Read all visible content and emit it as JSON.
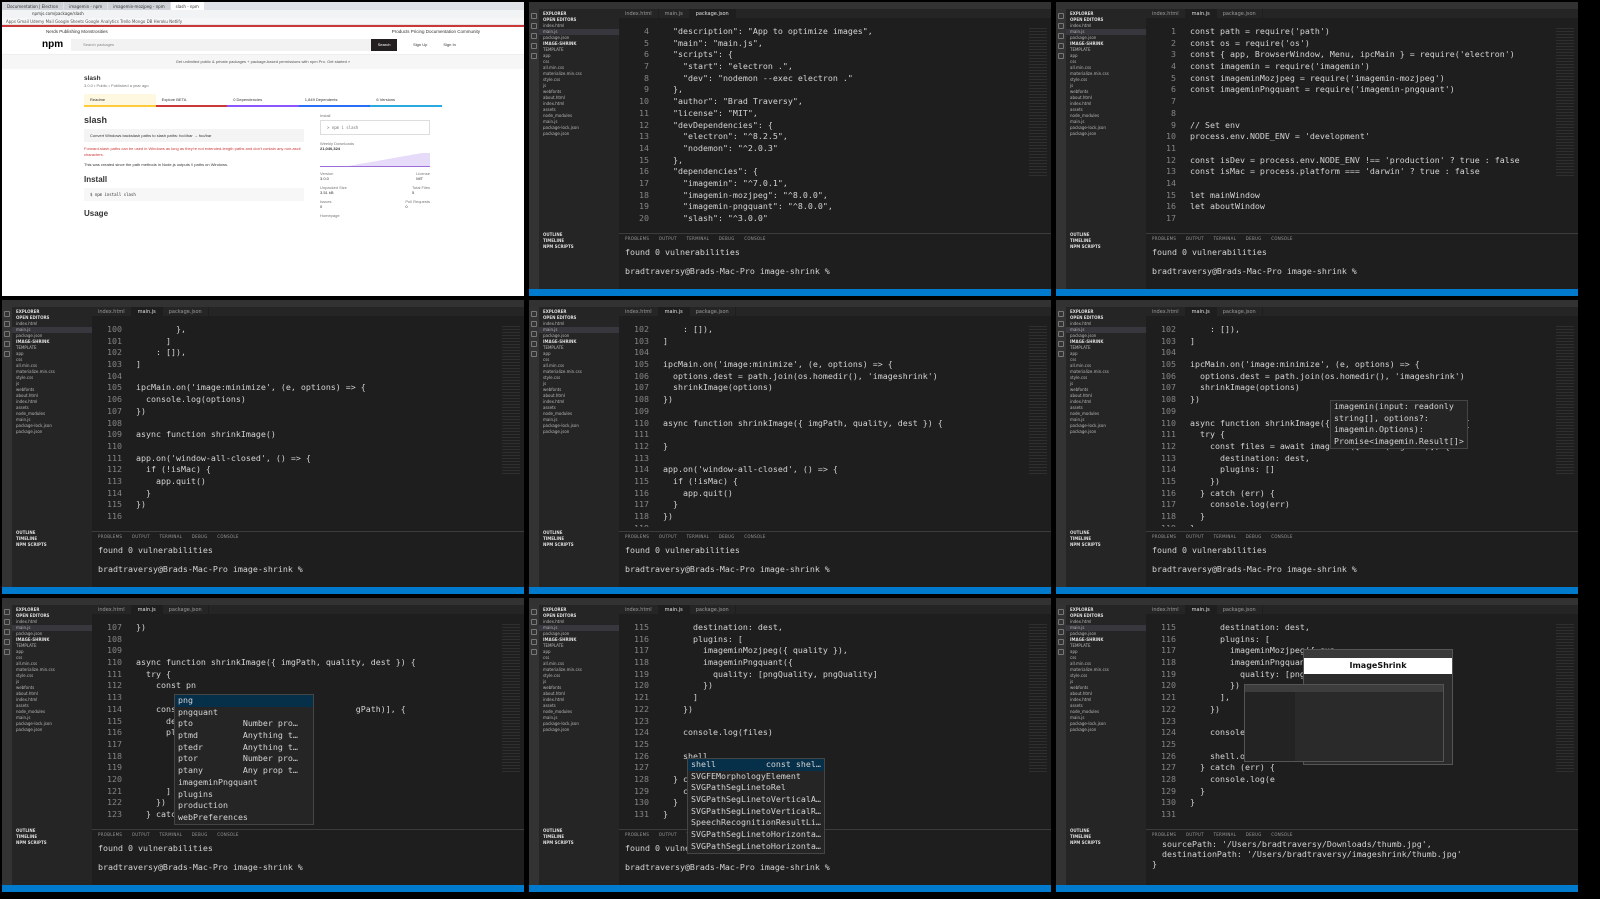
{
  "terminal": {
    "tabs": "PROBLEMS   OUTPUT   TERMINAL   DEBUG CONSOLE",
    "line1": "found 0 vulnerabilities",
    "prompt": "bradtraversy@Brads-Mac-Pro image-shrink % "
  },
  "explorer": {
    "header": "EXPLORER",
    "items": [
      "OPEN EDITORS",
      "index.html",
      "main.js",
      "package.json",
      "IMAGE-SHRINK",
      "TEMPLATE",
      "app",
      "css",
      "all.min.css",
      "materialize.min.css",
      "style.css",
      "js",
      "webfonts",
      "about.html",
      "index.html",
      "assets",
      "node_modules",
      "main.js",
      "package-lock.json",
      "package.json"
    ],
    "footer": [
      "OUTLINE",
      "TIMELINE",
      "NPM SCRIPTS"
    ]
  },
  "tabs": [
    "index.html",
    "main.js",
    "package.json"
  ],
  "browser": {
    "tabs": [
      "Documentation | Electron",
      "imagemin - npm",
      "imagemin-mozjpeg - npm",
      "slash - npm"
    ],
    "url": "npmjs.com/package/slash",
    "bookmarks": "Apps  Gmail  Udemy  Mail  Google Sheets  Google Analytics  Trello  Mongo DB  Heroku  Netlify",
    "top_left": "Nerds Publishing Monstrosities",
    "top_links": "Products   Pricing   Documentation   Community",
    "logo": "npm",
    "search_placeholder": "Search packages",
    "search_btn": "Search",
    "signup": "Sign Up",
    "signin": "Sign In",
    "promo": "Get unlimited public & private packages + package-based permissions with npm Pro.  Get started »",
    "pkg_name": "slash",
    "pkg_meta": "3.0.0 • Public • Published a year ago",
    "pkg_tabs": [
      "Readme",
      "Explore BETA",
      "0 Dependencies",
      "1,849 Dependents",
      "6 Versions"
    ],
    "title": "slash",
    "note": "Convert Windows backslash paths to slash paths: foo\\\\bar → foo/bar",
    "red": "Forward-slash paths can be used in Windows as long as they're not extended-length paths and don't contain any non-ascii characters.",
    "created": "This was created since the path methods in Node.js outputs \\\\ paths on Windows.",
    "install_h": "Install",
    "install_cmd": "$ npm install slash",
    "usage_h": "Usage",
    "side_install": "Install",
    "side_cmd": "> npm i slash",
    "weekly_label": "Weekly Downloads",
    "weekly": "21,040,324",
    "version_label": "Version",
    "version": "3.0.0",
    "license_label": "License",
    "license": "MIT",
    "size_label": "Unpacked Size",
    "size": "3.51 kB",
    "files_label": "Total Files",
    "files": "5",
    "issues_label": "Issues",
    "issues": "0",
    "prs_label": "Pull Requests",
    "prs": "0",
    "homepage_label": "Homepage"
  },
  "panels": [
    {
      "code": [
        [
          "4",
          "  \"description\": \"App to optimize images\","
        ],
        [
          "5",
          "  \"main\": \"main.js\","
        ],
        [
          "6",
          "  \"scripts\": {"
        ],
        [
          "7",
          "    \"start\": \"electron .\","
        ],
        [
          "8",
          "    \"dev\": \"nodemon --exec electron .\""
        ],
        [
          "9",
          "  },"
        ],
        [
          "10",
          "  \"author\": \"Brad Traversy\","
        ],
        [
          "11",
          "  \"license\": \"MIT\","
        ],
        [
          "12",
          "  \"devDependencies\": {"
        ],
        [
          "13",
          "    \"electron\": \"^8.2.5\","
        ],
        [
          "14",
          "    \"nodemon\": \"^2.0.3\""
        ],
        [
          "15",
          "  },"
        ],
        [
          "16",
          "  \"dependencies\": {"
        ],
        [
          "17",
          "    \"imagemin\": \"^7.0.1\","
        ],
        [
          "18",
          "    \"imagemin-mozjpeg\": \"^8.0.0\","
        ],
        [
          "19",
          "    \"imagemin-pngquant\": \"^8.0.0\","
        ],
        [
          "20",
          "    \"slash\": \"^3.0.0\""
        ]
      ]
    },
    {
      "code": [
        [
          "1",
          "const path = require('path')"
        ],
        [
          "2",
          "const os = require('os')"
        ],
        [
          "3",
          "const { app, BrowserWindow, Menu, ipcMain } = require('electron')"
        ],
        [
          "4",
          "const imagemin = require('imagemin')"
        ],
        [
          "5",
          "const imageminMozjpeg = require('imagemin-mozjpeg')"
        ],
        [
          "6",
          "const imageminPngquant = require('imagemin-pngquant')"
        ],
        [
          "7",
          ""
        ],
        [
          "8",
          ""
        ],
        [
          "9",
          "// Set env"
        ],
        [
          "10",
          "process.env.NODE_ENV = 'development'"
        ],
        [
          "11",
          ""
        ],
        [
          "12",
          "const isDev = process.env.NODE_ENV !== 'production' ? true : false"
        ],
        [
          "13",
          "const isMac = process.platform === 'darwin' ? true : false"
        ],
        [
          "14",
          ""
        ],
        [
          "15",
          "let mainWindow"
        ],
        [
          "16",
          "let aboutWindow"
        ],
        [
          "17",
          ""
        ]
      ]
    },
    {
      "code": [
        [
          "100",
          "        },"
        ],
        [
          "101",
          "      ]"
        ],
        [
          "102",
          "    : []),"
        ],
        [
          "103",
          "]"
        ],
        [
          "104",
          ""
        ],
        [
          "105",
          "ipcMain.on('image:minimize', (e, options) => {"
        ],
        [
          "106",
          "  console.log(options)"
        ],
        [
          "107",
          "})"
        ],
        [
          "108",
          ""
        ],
        [
          "109",
          "async function shrinkImage()"
        ],
        [
          "110",
          ""
        ],
        [
          "111",
          "app.on('window-all-closed', () => {"
        ],
        [
          "112",
          "  if (!isMac) {"
        ],
        [
          "113",
          "    app.quit()"
        ],
        [
          "114",
          "  }"
        ],
        [
          "115",
          "})"
        ],
        [
          "116",
          ""
        ]
      ]
    },
    {
      "code": [
        [
          "102",
          "    : []),"
        ],
        [
          "103",
          "]"
        ],
        [
          "104",
          ""
        ],
        [
          "105",
          "ipcMain.on('image:minimize', (e, options) => {"
        ],
        [
          "106",
          "  options.dest = path.join(os.homedir(), 'imageshrink')"
        ],
        [
          "107",
          "  shrinkImage(options)"
        ],
        [
          "108",
          "})"
        ],
        [
          "109",
          ""
        ],
        [
          "110",
          "async function shrinkImage({ imgPath, quality, dest }) {"
        ],
        [
          "111",
          ""
        ],
        [
          "112",
          "}"
        ],
        [
          "113",
          ""
        ],
        [
          "114",
          "app.on('window-all-closed', () => {"
        ],
        [
          "115",
          "  if (!isMac) {"
        ],
        [
          "116",
          "    app.quit()"
        ],
        [
          "117",
          "  }"
        ],
        [
          "118",
          "})"
        ],
        [
          "119",
          ""
        ]
      ]
    },
    {
      "code": [
        [
          "102",
          "    : []),"
        ],
        [
          "103",
          "]"
        ],
        [
          "104",
          ""
        ],
        [
          "105",
          "ipcMain.on('image:minimize', (e, options) => {"
        ],
        [
          "106",
          "  options.dest = path.join(os.homedir(), 'imageshrink')"
        ],
        [
          "107",
          "  shrinkImage(options)"
        ],
        [
          "108",
          "})"
        ],
        [
          "109",
          ""
        ],
        [
          "110",
          "async function shrinkImage({ imgPath, quality, dest }) {"
        ],
        [
          "111",
          "  try {"
        ],
        [
          "112",
          "    const files = await imagemin([slash(imgPath)], {"
        ],
        [
          "113",
          "      destination: dest,"
        ],
        [
          "114",
          "      plugins: []"
        ],
        [
          "115",
          "    })"
        ],
        [
          "116",
          "  } catch (err) {"
        ],
        [
          "117",
          "    console.log(err)"
        ],
        [
          "118",
          "  }"
        ],
        [
          "119",
          "}"
        ]
      ],
      "hover": [
        "imagemin(input: readonly",
        "string[], options?:",
        "imagemin.Options):",
        "Promise<imagemin.Result[]>"
      ]
    },
    {
      "code": [
        [
          "107",
          "})"
        ],
        [
          "108",
          ""
        ],
        [
          "109",
          ""
        ],
        [
          "110",
          "async function shrinkImage({ imgPath, quality, dest }) {"
        ],
        [
          "111",
          "  try {"
        ],
        [
          "112",
          "    const pn"
        ],
        [
          "113",
          ""
        ],
        [
          "114",
          "    const fi                                gPath)], {"
        ],
        [
          "115",
          "      destin"
        ],
        [
          "116",
          "      plugin"
        ],
        [
          "117",
          "        imag"
        ],
        [
          "118",
          "        imag"
        ],
        [
          "119",
          "          qu"
        ],
        [
          "120",
          "        })"
        ],
        [
          "121",
          "      ]"
        ],
        [
          "122",
          "    })"
        ],
        [
          "123",
          "  } catch (e"
        ]
      ],
      "suggest": [
        "png",
        "pngquant",
        "pto          Number pro…",
        "ptmd         Anything t…",
        "ptedr        Anything t…",
        "ptor         Number pro…",
        "ptany        Any prop t…",
        "imageminPngquant",
        "plugins",
        "production",
        "webPreferences"
      ]
    },
    {
      "code": [
        [
          "115",
          "      destination: dest,"
        ],
        [
          "116",
          "      plugins: ["
        ],
        [
          "117",
          "        imageminMozjpeg({ quality }),"
        ],
        [
          "118",
          "        imageminPngquant({"
        ],
        [
          "119",
          "          quality: [pngQuality, pngQuality]"
        ],
        [
          "120",
          "        })"
        ],
        [
          "121",
          "      ]"
        ],
        [
          "122",
          "    })"
        ],
        [
          "123",
          ""
        ],
        [
          "124",
          "    console.log(files)"
        ],
        [
          "125",
          ""
        ],
        [
          "126",
          "    shell"
        ],
        [
          "127",
          ""
        ],
        [
          "128",
          "  } catc"
        ],
        [
          "129",
          "    conso"
        ],
        [
          "130",
          "  }"
        ],
        [
          "131",
          "}"
        ]
      ],
      "suggest": [
        "shell          const shel…",
        "SVGFEMorphologyElement",
        "SVGPathSegLinetoRel",
        "SVGPathSegLinetoVerticalA…",
        "SVGPathSegLinetoVerticalR…",
        "SpeechRecognitionResultLi…",
        "SVGPathSegLinetoHorizonta…",
        "SVGPathSegLinetoHorizonta…"
      ]
    },
    {
      "code": [
        [
          "115",
          "      destination: dest,"
        ],
        [
          "116",
          "      plugins: ["
        ],
        [
          "117",
          "        imageminMozjpeg({ qua"
        ],
        [
          "118",
          "        imageminPngquant({"
        ],
        [
          "119",
          "          quality: [pngQual"
        ],
        [
          "120",
          "        })"
        ],
        [
          "121",
          "      ],"
        ],
        [
          "122",
          "    })"
        ],
        [
          "123",
          ""
        ],
        [
          "124",
          "    console.log(files)"
        ],
        [
          "125",
          ""
        ],
        [
          "126",
          "    shell.openIte"
        ],
        [
          "127",
          "  } catch (err) {"
        ],
        [
          "128",
          "    console.log(e"
        ],
        [
          "129",
          "  }"
        ],
        [
          "130",
          "}"
        ],
        [
          "131",
          ""
        ]
      ],
      "term": [
        "  sourcePath: '/Users/bradtraversy/Downloads/thumb.jpg',",
        "  destinationPath: '/Users/bradtraversy/imageshrink/thumb.jpg'",
        "}"
      ],
      "app_title": "ImageShrink"
    }
  ]
}
